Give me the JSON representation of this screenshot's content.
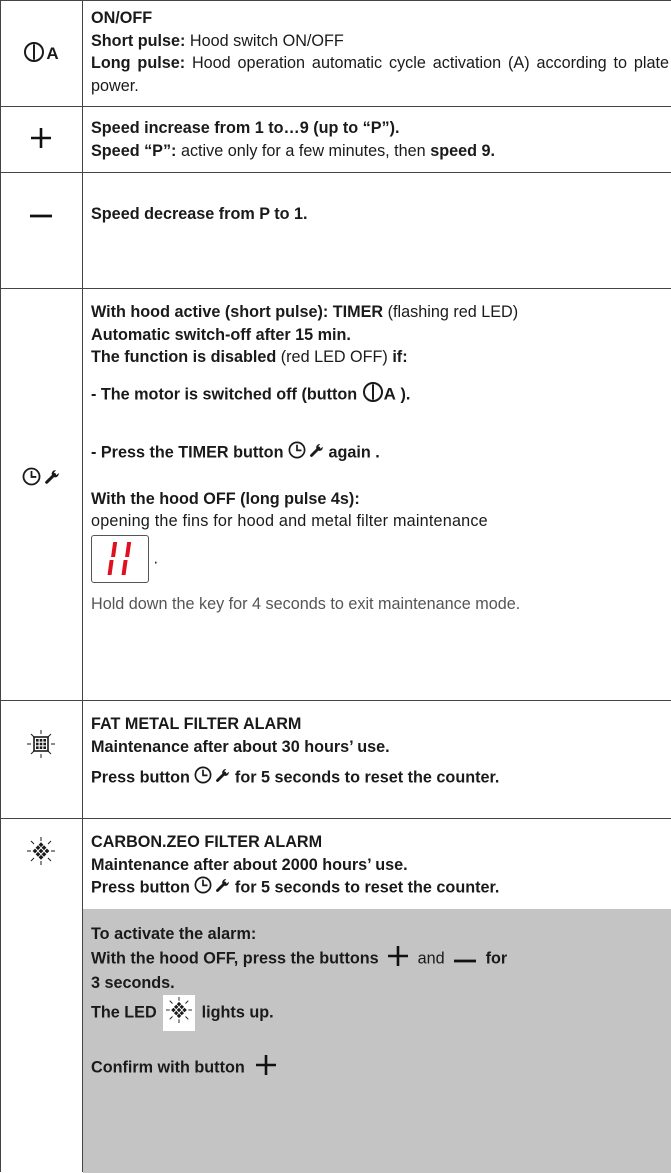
{
  "rows": {
    "onoff": {
      "icon_label": "A",
      "title": "ON/OFF",
      "short_label": "Short pulse:",
      "short_text": " Hood switch ON/OFF",
      "long_label": "Long pulse:",
      "long_text": " Hood operation automatic cycle activation (A) according to plate power."
    },
    "plus": {
      "line1": "Speed increase from 1 to…9 (up to “P”).",
      "line2_bold": "Speed “P”:",
      "line2_text": " active only for a few minutes, then ",
      "line2_end": "speed 9."
    },
    "minus": {
      "line1": "Speed decrease from P to 1."
    },
    "timer": {
      "l1_bold": "With hood active (short pulse): TIMER",
      "l1_text": " (flashing red LED)",
      "l2": "Automatic switch-off after 15 min.",
      "l3_bold": "The function is disabled",
      "l3_text": " (red LED OFF) ",
      "l3_end": "if:",
      "l4_start": "- The motor is switched off (button ",
      "l4_icon_label": "A",
      "l4_end": " ).",
      "l5_start": "- Press the TIMER button ",
      "l5_end": " again .",
      "l6": "With the hood OFF (long pulse 4s):",
      "l7": "opening the fins for hood and metal filter maintenance",
      "display_value": "11",
      "l8_dot": ".",
      "l9": "Hold down the key for 4 seconds to exit maintenance mode."
    },
    "fat": {
      "l1": "FAT METAL FILTER ALARM",
      "l2": "Maintenance after about 30 hours’ use.",
      "l3_start": "Press button ",
      "l3_end": " for 5 seconds to reset the counter."
    },
    "carbon": {
      "l1": "CARBON.ZEO FILTER ALARM",
      "l2": "Maintenance after about 2000 hours’ use.",
      "l3_start": "Press button ",
      "l3_end": " for 5 seconds to reset the counter.",
      "g1": "To activate the alarm:",
      "g2_start": "With the hood OFF, press the buttons ",
      "g2_and": " and ",
      "g2_for": " for",
      "g3": "3 seconds.",
      "g4_start": "The LED ",
      "g4_end": " lights up.",
      "g5": "Confirm with button"
    }
  },
  "colors": {
    "border": "#444444",
    "gray_block": "#c4c4c4",
    "led_red": "#e01020"
  },
  "icons": [
    "power-icon",
    "plus-icon",
    "minus-icon",
    "clock-icon",
    "wrench-icon",
    "grid-filter-icon",
    "carbon-filter-icon",
    "seven-segment-display"
  ]
}
